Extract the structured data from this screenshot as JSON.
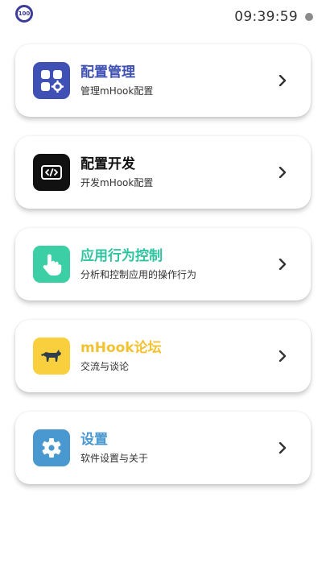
{
  "status_bar": {
    "battery_level": "100",
    "time": "09:39:59"
  },
  "menu": [
    {
      "title": "配置管理",
      "subtitle": "管理mHook配置",
      "icon": "grid-gear-icon",
      "title_color": "#3f51b5",
      "icon_bg": "#3f51b5"
    },
    {
      "title": "配置开发",
      "subtitle": "开发mHook配置",
      "icon": "code-icon",
      "title_color": "#111111",
      "icon_bg": "#111111"
    },
    {
      "title": "应用行为控制",
      "subtitle": "分析和控制应用的操作行为",
      "icon": "hand-pointer-icon",
      "title_color": "#2ec4a0",
      "icon_bg": "#3ccfa6"
    },
    {
      "title": "mHook论坛",
      "subtitle": "交流与谈论",
      "icon": "dog-icon",
      "title_color": "#f2c230",
      "icon_bg": "#f9cf3d"
    },
    {
      "title": "设置",
      "subtitle": "软件设置与关于",
      "icon": "gear-icon",
      "title_color": "#4a98d0",
      "icon_bg": "#4a98d0"
    }
  ]
}
